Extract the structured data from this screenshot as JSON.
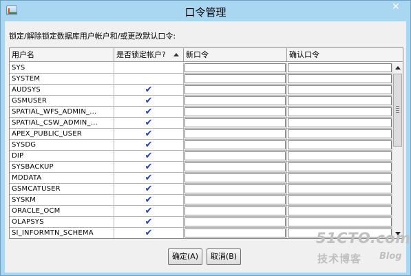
{
  "window": {
    "title": "口令管理",
    "close_glyph": "✕",
    "accent": "#a9d7f2"
  },
  "instruction": "锁定/解除锁定数据库用户帐户和/或更改默认口令:",
  "table": {
    "headers": {
      "user": "用户名",
      "locked": "是否锁定帐户?",
      "new_password": "新口令",
      "confirm_password": "确认口令"
    },
    "sort": {
      "column": "locked",
      "direction": "ascending"
    },
    "check_glyph": "✔",
    "check_color": "#1c3fb0",
    "rows": [
      {
        "user": "SYS",
        "locked": false
      },
      {
        "user": "SYSTEM",
        "locked": false
      },
      {
        "user": "AUDSYS",
        "locked": true
      },
      {
        "user": "GSMUSER",
        "locked": true
      },
      {
        "user": "SPATIAL_WFS_ADMIN_...",
        "locked": true
      },
      {
        "user": "SPATIAL_CSW_ADMIN_...",
        "locked": true
      },
      {
        "user": "APEX_PUBLIC_USER",
        "locked": true
      },
      {
        "user": "SYSDG",
        "locked": true
      },
      {
        "user": "DIP",
        "locked": true
      },
      {
        "user": "SYSBACKUP",
        "locked": true
      },
      {
        "user": "MDDATA",
        "locked": true
      },
      {
        "user": "GSMCATUSER",
        "locked": true
      },
      {
        "user": "SYSKM",
        "locked": true
      },
      {
        "user": "ORACLE_OCM",
        "locked": true
      },
      {
        "user": "OLAPSYS",
        "locked": true
      },
      {
        "user": "SI_INFORMTN_SCHEMA",
        "locked": true
      }
    ]
  },
  "buttons": {
    "ok": "确定(A)",
    "cancel": "取消(B)"
  },
  "watermark": {
    "main": "51CTO.com",
    "sub": "技术博客",
    "blog": "Blog"
  }
}
